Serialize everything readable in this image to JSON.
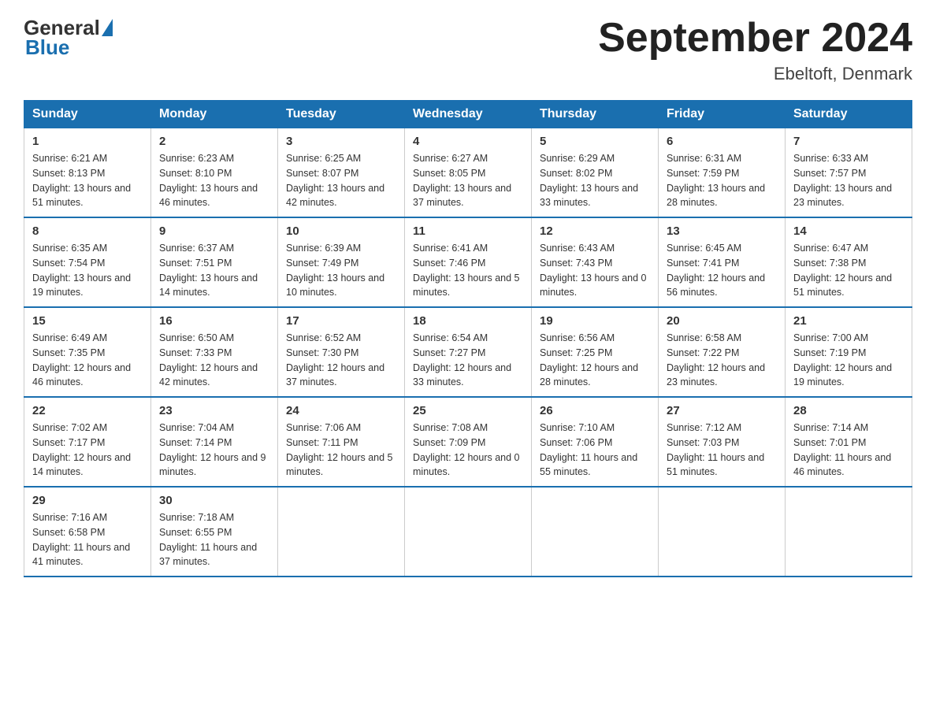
{
  "logo": {
    "text_general": "General",
    "text_blue": "Blue"
  },
  "title": "September 2024",
  "subtitle": "Ebeltoft, Denmark",
  "days_of_week": [
    "Sunday",
    "Monday",
    "Tuesday",
    "Wednesday",
    "Thursday",
    "Friday",
    "Saturday"
  ],
  "weeks": [
    [
      {
        "day": "1",
        "sunrise": "6:21 AM",
        "sunset": "8:13 PM",
        "daylight": "13 hours and 51 minutes."
      },
      {
        "day": "2",
        "sunrise": "6:23 AM",
        "sunset": "8:10 PM",
        "daylight": "13 hours and 46 minutes."
      },
      {
        "day": "3",
        "sunrise": "6:25 AM",
        "sunset": "8:07 PM",
        "daylight": "13 hours and 42 minutes."
      },
      {
        "day": "4",
        "sunrise": "6:27 AM",
        "sunset": "8:05 PM",
        "daylight": "13 hours and 37 minutes."
      },
      {
        "day": "5",
        "sunrise": "6:29 AM",
        "sunset": "8:02 PM",
        "daylight": "13 hours and 33 minutes."
      },
      {
        "day": "6",
        "sunrise": "6:31 AM",
        "sunset": "7:59 PM",
        "daylight": "13 hours and 28 minutes."
      },
      {
        "day": "7",
        "sunrise": "6:33 AM",
        "sunset": "7:57 PM",
        "daylight": "13 hours and 23 minutes."
      }
    ],
    [
      {
        "day": "8",
        "sunrise": "6:35 AM",
        "sunset": "7:54 PM",
        "daylight": "13 hours and 19 minutes."
      },
      {
        "day": "9",
        "sunrise": "6:37 AM",
        "sunset": "7:51 PM",
        "daylight": "13 hours and 14 minutes."
      },
      {
        "day": "10",
        "sunrise": "6:39 AM",
        "sunset": "7:49 PM",
        "daylight": "13 hours and 10 minutes."
      },
      {
        "day": "11",
        "sunrise": "6:41 AM",
        "sunset": "7:46 PM",
        "daylight": "13 hours and 5 minutes."
      },
      {
        "day": "12",
        "sunrise": "6:43 AM",
        "sunset": "7:43 PM",
        "daylight": "13 hours and 0 minutes."
      },
      {
        "day": "13",
        "sunrise": "6:45 AM",
        "sunset": "7:41 PM",
        "daylight": "12 hours and 56 minutes."
      },
      {
        "day": "14",
        "sunrise": "6:47 AM",
        "sunset": "7:38 PM",
        "daylight": "12 hours and 51 minutes."
      }
    ],
    [
      {
        "day": "15",
        "sunrise": "6:49 AM",
        "sunset": "7:35 PM",
        "daylight": "12 hours and 46 minutes."
      },
      {
        "day": "16",
        "sunrise": "6:50 AM",
        "sunset": "7:33 PM",
        "daylight": "12 hours and 42 minutes."
      },
      {
        "day": "17",
        "sunrise": "6:52 AM",
        "sunset": "7:30 PM",
        "daylight": "12 hours and 37 minutes."
      },
      {
        "day": "18",
        "sunrise": "6:54 AM",
        "sunset": "7:27 PM",
        "daylight": "12 hours and 33 minutes."
      },
      {
        "day": "19",
        "sunrise": "6:56 AM",
        "sunset": "7:25 PM",
        "daylight": "12 hours and 28 minutes."
      },
      {
        "day": "20",
        "sunrise": "6:58 AM",
        "sunset": "7:22 PM",
        "daylight": "12 hours and 23 minutes."
      },
      {
        "day": "21",
        "sunrise": "7:00 AM",
        "sunset": "7:19 PM",
        "daylight": "12 hours and 19 minutes."
      }
    ],
    [
      {
        "day": "22",
        "sunrise": "7:02 AM",
        "sunset": "7:17 PM",
        "daylight": "12 hours and 14 minutes."
      },
      {
        "day": "23",
        "sunrise": "7:04 AM",
        "sunset": "7:14 PM",
        "daylight": "12 hours and 9 minutes."
      },
      {
        "day": "24",
        "sunrise": "7:06 AM",
        "sunset": "7:11 PM",
        "daylight": "12 hours and 5 minutes."
      },
      {
        "day": "25",
        "sunrise": "7:08 AM",
        "sunset": "7:09 PM",
        "daylight": "12 hours and 0 minutes."
      },
      {
        "day": "26",
        "sunrise": "7:10 AM",
        "sunset": "7:06 PM",
        "daylight": "11 hours and 55 minutes."
      },
      {
        "day": "27",
        "sunrise": "7:12 AM",
        "sunset": "7:03 PM",
        "daylight": "11 hours and 51 minutes."
      },
      {
        "day": "28",
        "sunrise": "7:14 AM",
        "sunset": "7:01 PM",
        "daylight": "11 hours and 46 minutes."
      }
    ],
    [
      {
        "day": "29",
        "sunrise": "7:16 AM",
        "sunset": "6:58 PM",
        "daylight": "11 hours and 41 minutes."
      },
      {
        "day": "30",
        "sunrise": "7:18 AM",
        "sunset": "6:55 PM",
        "daylight": "11 hours and 37 minutes."
      },
      null,
      null,
      null,
      null,
      null
    ]
  ],
  "labels": {
    "sunrise": "Sunrise:",
    "sunset": "Sunset:",
    "daylight": "Daylight:"
  }
}
